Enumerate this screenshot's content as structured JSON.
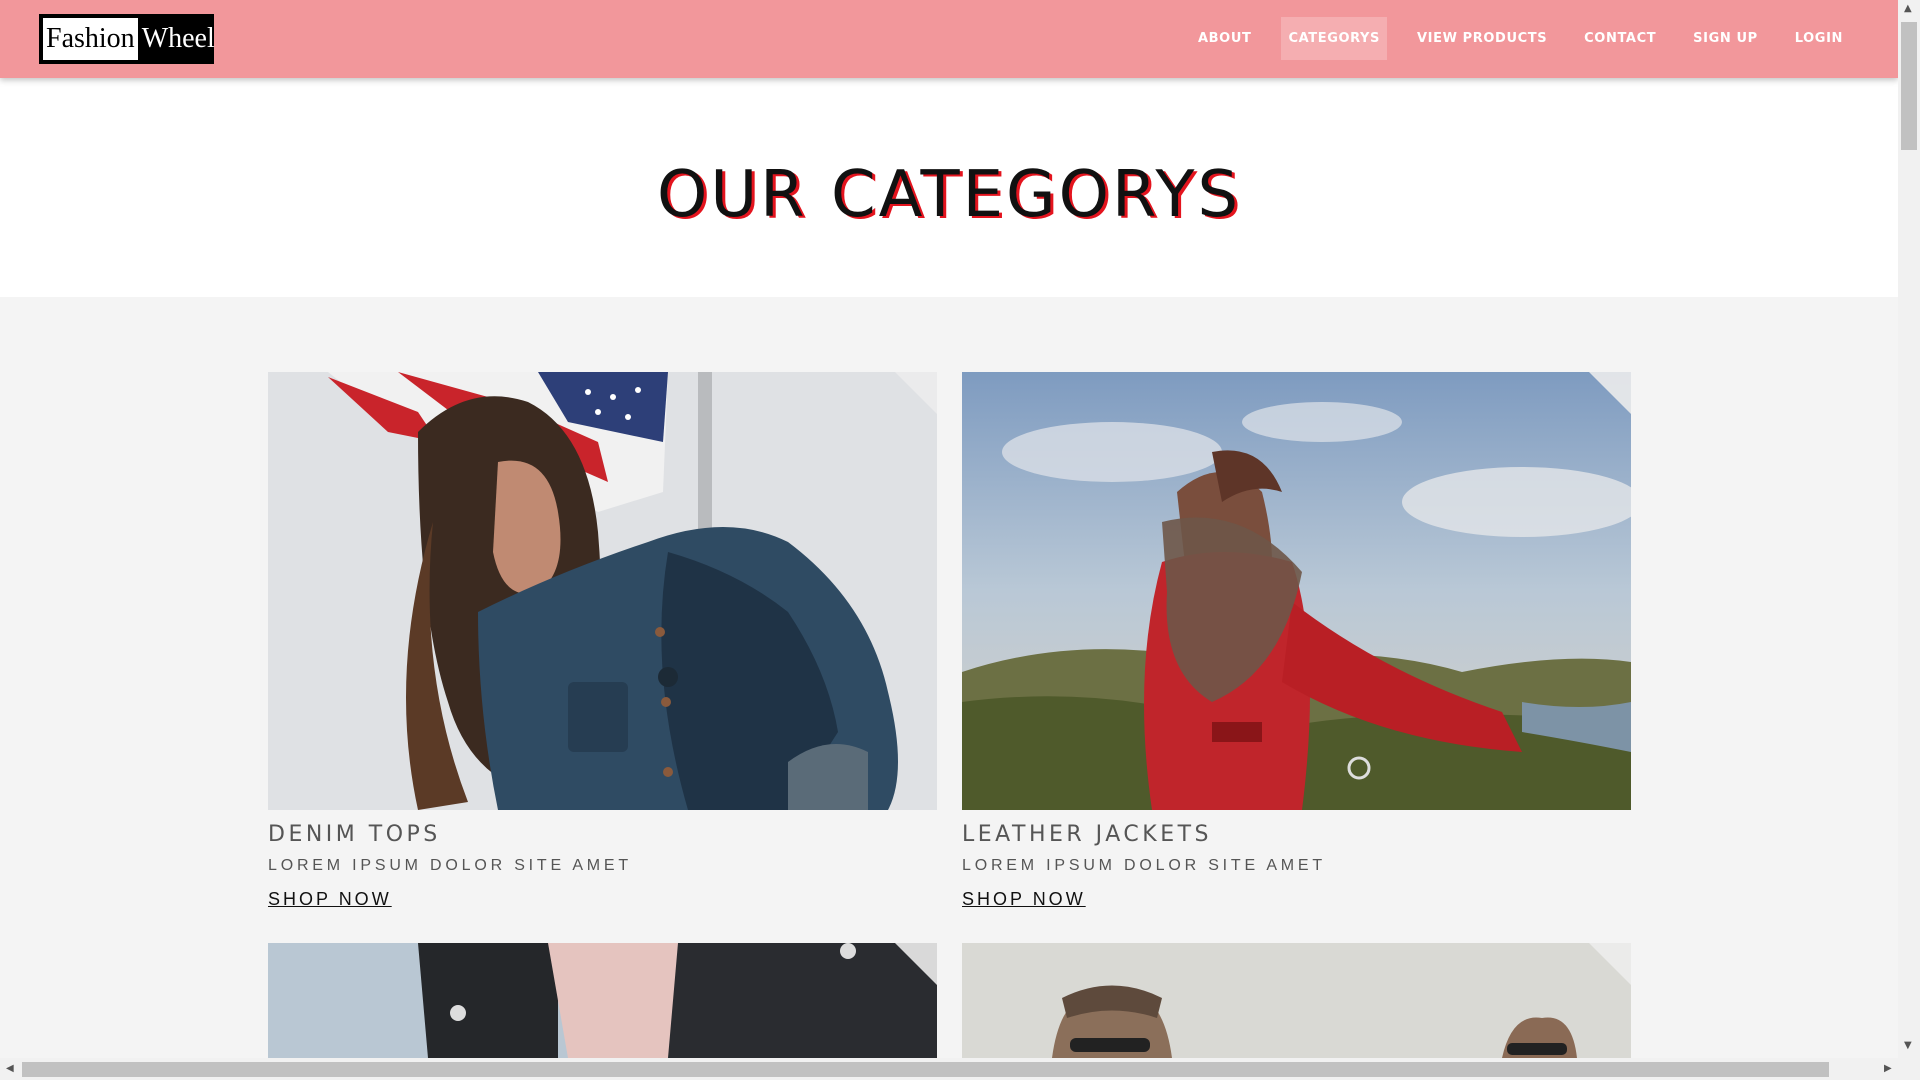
{
  "brand": {
    "logo_part1": "Fashion",
    "logo_part2": "Wheel"
  },
  "nav": {
    "items": [
      {
        "label": "ABOUT",
        "active": false
      },
      {
        "label": "CATEGORYS",
        "active": true
      },
      {
        "label": "VIEW PRODUCTS",
        "active": false
      },
      {
        "label": "CONTACT",
        "active": false
      },
      {
        "label": "SIGN UP",
        "active": false
      },
      {
        "label": "LOGIN",
        "active": false
      }
    ]
  },
  "hero": {
    "title": "OUR CATEGORYS"
  },
  "categories": [
    {
      "title": "DENIM TOPS",
      "subtitle": "LOREM IPSUM DOLOR SITE AMET",
      "link": "SHOP NOW",
      "image": "woman-in-denim-jacket-photo"
    },
    {
      "title": "LEATHER JACKETS",
      "subtitle": "LOREM IPSUM DOLOR SITE AMET",
      "link": "SHOP NOW",
      "image": "woman-in-red-coat-photo"
    },
    {
      "image": "leather-jacket-photo"
    },
    {
      "image": "men-with-sunglasses-photo"
    }
  ],
  "colors": {
    "header_bg": "#f2979b",
    "nav_active_bg": "#f5aeb1",
    "title_shadow": "#e4141e",
    "section_bg": "#f4f4f4"
  }
}
